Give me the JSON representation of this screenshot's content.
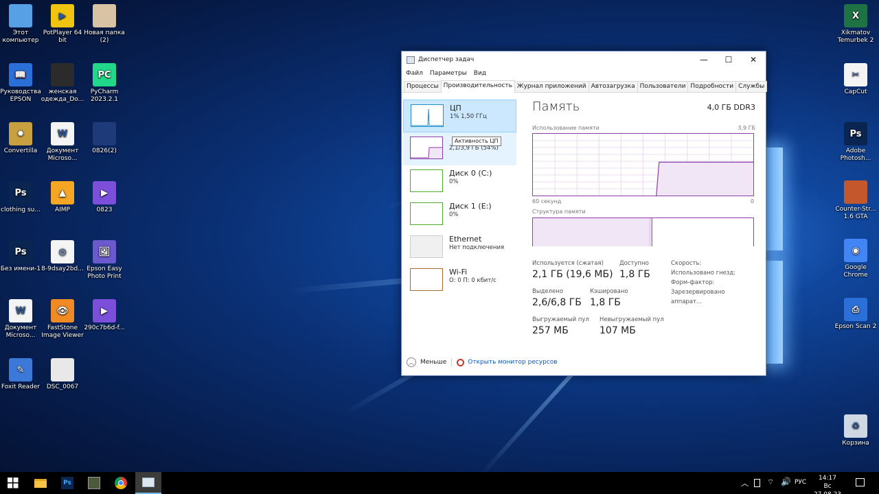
{
  "desktop_left": [
    {
      "label": "Этот компьютер",
      "icon": "this-pc-icon",
      "color": "#57a0e6",
      "glyph": ""
    },
    {
      "label": "PotPlayer 64 bit",
      "icon": "potplayer-icon",
      "color": "#f1c40f",
      "glyph": "▶"
    },
    {
      "label": "Новая папка (2)",
      "icon": "photo-folder-icon",
      "color": "#d8c3a4",
      "glyph": ""
    },
    {
      "label": "Руководства EPSON",
      "icon": "epson-manuals-icon",
      "color": "#2b6fd8",
      "glyph": "📖"
    },
    {
      "label": "женская одежда_Do...",
      "icon": "clothing-image-icon",
      "color": "#2b2b2b",
      "glyph": ""
    },
    {
      "label": "PyCharm 2023.2.1",
      "icon": "pycharm-icon",
      "color": "#21d789",
      "glyph": "PC"
    },
    {
      "label": "Convertilla",
      "icon": "convertilla-icon",
      "color": "#c8a040",
      "glyph": "✹"
    },
    {
      "label": "Документ Microso...",
      "icon": "word-document-icon",
      "color": "#f4f4f4",
      "glyph": "W"
    },
    {
      "label": "0826(2)",
      "icon": "video-thumbnail-icon",
      "color": "#1f3a78",
      "glyph": ""
    },
    {
      "label": "clothing su...",
      "icon": "photoshop-file-icon",
      "color": "#0a2550",
      "glyph": "Ps"
    },
    {
      "label": "AIMP",
      "icon": "aimp-icon",
      "color": "#f5a623",
      "glyph": "▲"
    },
    {
      "label": "0823",
      "icon": "mp4-file-icon",
      "color": "#7b4fd9",
      "glyph": "▶"
    },
    {
      "label": "Без имени-1",
      "icon": "photoshop-file-icon",
      "color": "#0a2550",
      "glyph": "Ps"
    },
    {
      "label": "8-9dsay2bd...",
      "icon": "document-file-icon",
      "color": "#f4f4f4",
      "glyph": "◎"
    },
    {
      "label": "Epson Easy Photo Print",
      "icon": "epson-photo-print-icon",
      "color": "#6a5acd",
      "glyph": "🖼"
    },
    {
      "label": "Документ Microso...",
      "icon": "word-document-icon",
      "color": "#f4f4f4",
      "glyph": "W"
    },
    {
      "label": "FastStone Image Viewer",
      "icon": "faststone-icon",
      "color": "#f08a24",
      "glyph": "👁"
    },
    {
      "label": "290c7b6d-f...",
      "icon": "mp4-file-icon",
      "color": "#7b4fd9",
      "glyph": "▶"
    },
    {
      "label": "Foxit Reader",
      "icon": "foxit-reader-icon",
      "color": "#3b78d8",
      "glyph": "✎"
    },
    {
      "label": "DSC_0067",
      "icon": "photo-file-icon",
      "color": "#e8e8e8",
      "glyph": ""
    }
  ],
  "desktop_right": [
    {
      "label": "Xikmatov Temurbek 2",
      "icon": "excel-file-icon",
      "color": "#1f7244",
      "glyph": "X"
    },
    {
      "label": "CapCut",
      "icon": "capcut-icon",
      "color": "#f4f4f4",
      "glyph": "✂"
    },
    {
      "label": "Adobe Photosh...",
      "icon": "photoshop-app-icon",
      "color": "#0a2550",
      "glyph": "Ps"
    },
    {
      "label": "Counter-Str... 1.6 GTA",
      "icon": "counter-strike-icon",
      "color": "#c4572c",
      "glyph": ""
    },
    {
      "label": "Google Chrome",
      "icon": "chrome-icon",
      "color": "#4285f4",
      "glyph": "◉"
    },
    {
      "label": "Epson Scan 2",
      "icon": "epson-scan-icon",
      "color": "#2b6fd8",
      "glyph": "⎙"
    },
    {
      "label": "Корзина",
      "icon": "recycle-bin-icon",
      "color": "#cfd8e3",
      "glyph": "♻"
    }
  ],
  "task_manager": {
    "title": "Диспетчер задач",
    "menu": [
      "Файл",
      "Параметры",
      "Вид"
    ],
    "tabs": [
      "Процессы",
      "Производительность",
      "Журнал приложений",
      "Автозагрузка",
      "Пользователи",
      "Подробности",
      "Службы"
    ],
    "active_tab": 1,
    "sidebar": [
      {
        "name": "ЦП",
        "value": "1% 1,50 ГГц",
        "color": "#1e8fc8"
      },
      {
        "name": "Память",
        "value": "2,1/3,9 ГБ (54%)",
        "color": "#8b3fa8"
      },
      {
        "name": "Диск 0 (C:)",
        "value": "0%",
        "color": "#4ca82a"
      },
      {
        "name": "Диск 1 (E:)",
        "value": "0%",
        "color": "#4ca82a"
      },
      {
        "name": "Ethernet",
        "value": "Нет подключения",
        "color": "#bbbbbb"
      },
      {
        "name": "Wi-Fi",
        "value": "О: 0 П: 0 кбит/с",
        "color": "#a86a2a"
      }
    ],
    "tooltip": "Активность ЦП",
    "panel": {
      "title": "Память",
      "type": "4,0 ГБ DDR3",
      "usage_label": "Использование памяти",
      "usage_max": "3,9 ГБ",
      "time_label": "60 секунд",
      "time_end": "0",
      "structure_label": "Структура памяти",
      "usage_level": 0.54,
      "structure_used": 0.54,
      "stats": [
        {
          "label": "Используется (сжатая)",
          "value": "2,1 ГБ (19,6 МБ)"
        },
        {
          "label": "Доступно",
          "value": "1,8 ГБ"
        },
        {
          "label": "Выделено",
          "value": "2,6/6,8 ГБ"
        },
        {
          "label": "Кэшировано",
          "value": "1,8 ГБ"
        },
        {
          "label": "Выгружаемый пул",
          "value": "257 МБ"
        },
        {
          "label": "Невыгружаемый пул",
          "value": "107 МБ"
        }
      ],
      "right_labels": [
        "Скорость:",
        "Использовано гнезд:",
        "Форм-фактор:",
        "Зарезервировано аппарат..."
      ]
    },
    "footer": {
      "less": "Меньше",
      "monitor": "Открыть монитор ресурсов"
    }
  },
  "taskbar": {
    "lang": "РУС",
    "time": "14:17",
    "date": "Вс 27.08.23"
  }
}
